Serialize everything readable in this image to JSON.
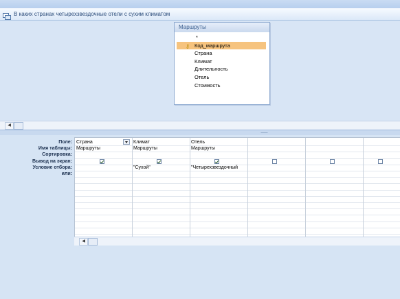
{
  "window": {
    "title": "В каких странах четырехзвездочные отели с сухим климатом"
  },
  "table": {
    "name": "Маршруты",
    "fields": [
      {
        "label": "*",
        "key": false,
        "selected": false
      },
      {
        "label": "Код_маршрута",
        "key": true,
        "selected": true
      },
      {
        "label": "Страна",
        "key": false,
        "selected": false
      },
      {
        "label": "Климат",
        "key": false,
        "selected": false
      },
      {
        "label": "Длительность",
        "key": false,
        "selected": false
      },
      {
        "label": "Отель",
        "key": false,
        "selected": false
      },
      {
        "label": "Стоимость",
        "key": false,
        "selected": false
      }
    ]
  },
  "row_labels": [
    "Поле:",
    "Имя таблицы:",
    "Сортировка:",
    "Вывод на экран:",
    "Условие отбора:",
    "или:"
  ],
  "columns": [
    {
      "field": "Страна",
      "table": "Маршруты",
      "sort": "",
      "show": true,
      "criteria": "",
      "or": "",
      "dropdown": true
    },
    {
      "field": "Климат",
      "table": "Маршруты",
      "sort": "",
      "show": true,
      "criteria": "\"Сухой\"",
      "or": ""
    },
    {
      "field": "Отель",
      "table": "Маршруты",
      "sort": "",
      "show": true,
      "criteria": "\"Четырехзвездочный",
      "or": ""
    },
    {
      "field": "",
      "table": "",
      "sort": "",
      "show": false,
      "criteria": "",
      "or": ""
    },
    {
      "field": "",
      "table": "",
      "sort": "",
      "show": false,
      "criteria": "",
      "or": ""
    },
    {
      "field": "",
      "table": "",
      "sort": "",
      "show": false,
      "criteria": "",
      "or": ""
    }
  ],
  "colors": {
    "selected_field": "#f6c37e",
    "key_icon": "#b58a00"
  }
}
